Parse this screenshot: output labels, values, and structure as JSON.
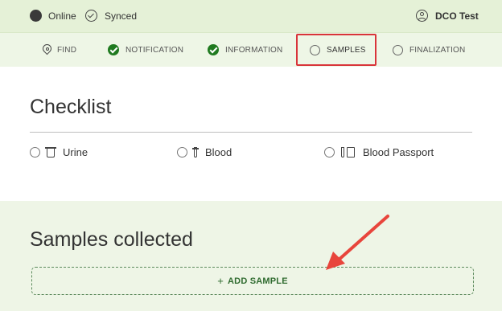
{
  "topbar": {
    "online_label": "Online",
    "synced_label": "Synced",
    "user_label": "DCO Test"
  },
  "tabs": [
    {
      "label": "FIND",
      "state": "pin"
    },
    {
      "label": "NOTIFICATION",
      "state": "done"
    },
    {
      "label": "INFORMATION",
      "state": "done"
    },
    {
      "label": "SAMPLES",
      "state": "active"
    },
    {
      "label": "FINALIZATION",
      "state": "pending"
    }
  ],
  "checklist": {
    "title": "Checklist",
    "options": [
      {
        "label": "Urine",
        "icon": "urine-cup-icon"
      },
      {
        "label": "Blood",
        "icon": "blood-tube-icon"
      },
      {
        "label": "Blood Passport",
        "icon": "blood-passport-icon"
      }
    ]
  },
  "samples": {
    "title": "Samples collected",
    "add_label": "ADD SAMPLE",
    "add_icon": "+"
  },
  "colors": {
    "topbar_bg": "#e5f1d7",
    "done_green": "#1f7a1f",
    "highlight_red": "#d9343a",
    "annotation_arrow": "#e8453c"
  }
}
